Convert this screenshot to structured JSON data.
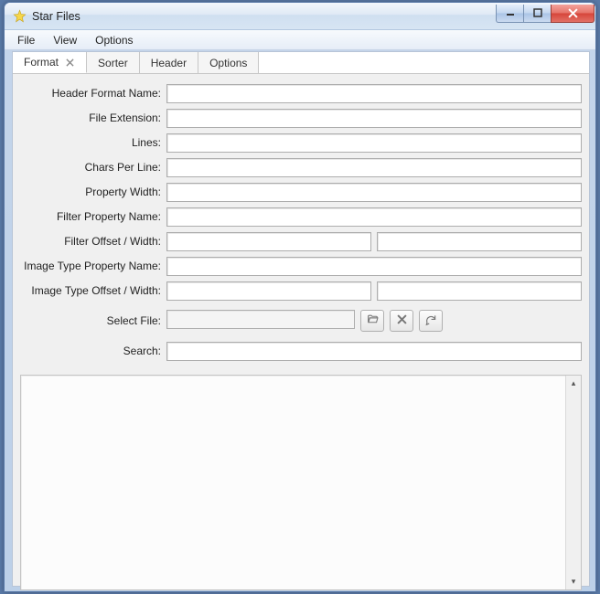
{
  "window": {
    "title": "Star Files"
  },
  "menubar": {
    "items": [
      "File",
      "View",
      "Options"
    ]
  },
  "tabs": [
    {
      "label": "Format",
      "active": true,
      "closable": true
    },
    {
      "label": "Sorter",
      "active": false,
      "closable": false
    },
    {
      "label": "Header",
      "active": false,
      "closable": false
    },
    {
      "label": "Options",
      "active": false,
      "closable": false
    }
  ],
  "form": {
    "labels": {
      "header_format_name": "Header Format Name:",
      "file_extension": "File Extension:",
      "lines": "Lines:",
      "chars_per_line": "Chars Per Line:",
      "property_width": "Property Width:",
      "filter_property_name": "Filter Property Name:",
      "filter_offset_width": "Filter Offset / Width:",
      "image_type_property_name": "Image Type Property Name:",
      "image_type_offset_width": "Image Type Offset / Width:",
      "select_file": "Select File:",
      "search": "Search:"
    },
    "values": {
      "header_format_name": "",
      "file_extension": "",
      "lines": "",
      "chars_per_line": "",
      "property_width": "",
      "filter_property_name": "",
      "filter_offset": "",
      "filter_width": "",
      "image_type_property_name": "",
      "image_type_offset": "",
      "image_type_width": "",
      "select_file": "",
      "search": ""
    }
  },
  "icons": {
    "app": "star-icon",
    "minimize": "minimize-icon",
    "maximize": "maximize-icon",
    "close": "close-icon",
    "browse": "folder-open-icon",
    "clear": "x-icon",
    "refresh": "refresh-icon"
  }
}
